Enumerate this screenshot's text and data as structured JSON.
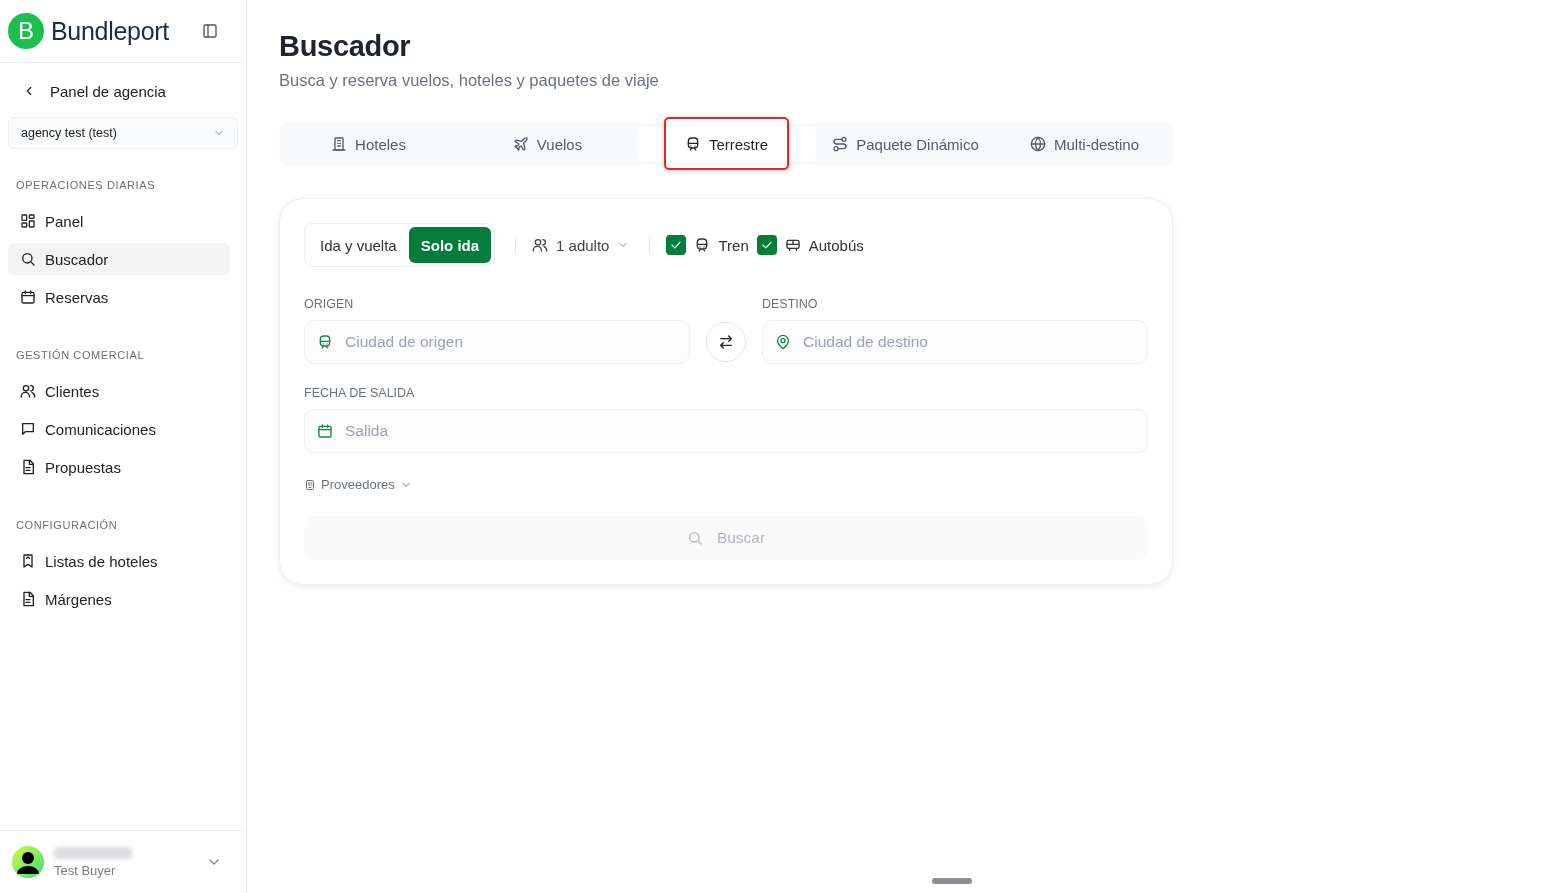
{
  "brand": {
    "logo_letter": "B",
    "name": "Bundleport"
  },
  "sidebar": {
    "back_link": "Panel de agencia",
    "agency_select": "agency test (test)",
    "sections": [
      {
        "title": "OPERACIONES DIARIAS",
        "items": [
          {
            "label": "Panel",
            "selected": false
          },
          {
            "label": "Buscador",
            "selected": true
          },
          {
            "label": "Reservas",
            "selected": false
          }
        ]
      },
      {
        "title": "GESTIÓN COMERCIAL",
        "items": [
          {
            "label": "Clientes",
            "selected": false
          },
          {
            "label": "Comunicaciones",
            "selected": false
          },
          {
            "label": "Propuestas",
            "selected": false
          }
        ]
      },
      {
        "title": "CONFIGURACIÓN",
        "items": [
          {
            "label": "Listas de hoteles",
            "selected": false
          },
          {
            "label": "Márgenes",
            "selected": false
          }
        ]
      }
    ]
  },
  "user": {
    "role": "Test Buyer"
  },
  "page": {
    "title": "Buscador",
    "subtitle": "Busca y reserva vuelos, hoteles y paquetes de viaje"
  },
  "tabs": [
    {
      "label": "Hoteles",
      "selected": false,
      "highlighted": false
    },
    {
      "label": "Vuelos",
      "selected": false,
      "highlighted": false
    },
    {
      "label": "Terrestre",
      "selected": true,
      "highlighted": true
    },
    {
      "label": "Paquete Dinámico",
      "selected": false,
      "highlighted": false
    },
    {
      "label": "Multi-destino",
      "selected": false,
      "highlighted": false
    }
  ],
  "form": {
    "trip_type": [
      {
        "label": "Ida y vuelta",
        "selected": false
      },
      {
        "label": "Solo ida",
        "selected": true
      }
    ],
    "passengers": "1 adulto",
    "transport": [
      {
        "label": "Tren",
        "checked": true
      },
      {
        "label": "Autobús",
        "checked": true
      }
    ],
    "origin": {
      "label": "ORIGEN",
      "placeholder": "Ciudad de origen"
    },
    "destination": {
      "label": "DESTINO",
      "placeholder": "Ciudad de destino"
    },
    "date": {
      "label": "FECHA DE SALIDA",
      "placeholder": "Salida"
    },
    "providers": "Proveedores",
    "search_button": {
      "label": "Buscar",
      "disabled": true
    }
  }
}
